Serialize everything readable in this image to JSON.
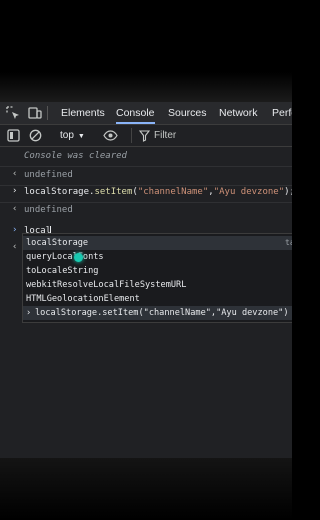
{
  "tabs": [
    {
      "label": "Elements"
    },
    {
      "label": "Console"
    },
    {
      "label": "Sources"
    },
    {
      "label": "Network"
    },
    {
      "label": "Perfo"
    }
  ],
  "toolbar": {
    "context": "top",
    "filter_label": "Filter"
  },
  "console": {
    "cleared": "Console was cleared",
    "undefined_1": "undefined",
    "cmd_prefix": "localStorage.",
    "cmd_fn": "setItem",
    "cmd_open": "(",
    "cmd_arg1": "\"channelName\"",
    "cmd_comma": ",",
    "cmd_arg2": "\"Ayu devzone\"",
    "cmd_close": ");",
    "undefined_2": "undefined",
    "input_value": "local"
  },
  "autocomplete": {
    "items": [
      {
        "label": "localStorage",
        "hint": "ta"
      },
      {
        "label": "queryLocalFonts"
      },
      {
        "label": "toLocaleString"
      },
      {
        "label": "webkitResolveLocalFileSystemURL"
      },
      {
        "label": "HTMLGeolocationElement"
      },
      {
        "label": "localStorage.setItem(\"channelName\",\"Ayu devzone\")"
      }
    ]
  },
  "colors": {
    "accent": "#8ab4f8",
    "string": "#ce9178",
    "function": "#dcdcaa",
    "cursor": "#19c9b0"
  }
}
